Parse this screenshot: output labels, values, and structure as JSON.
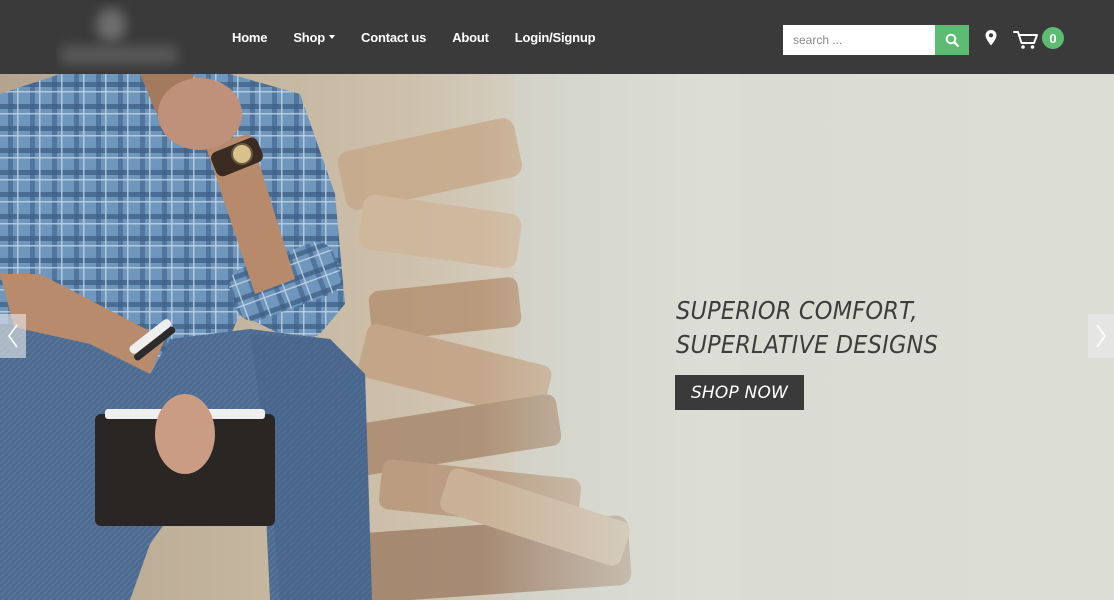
{
  "header": {
    "nav": [
      {
        "label": "Home"
      },
      {
        "label": "Shop",
        "has_dropdown": true
      },
      {
        "label": "Contact us"
      },
      {
        "label": "About"
      },
      {
        "label": "Login/Signup"
      }
    ],
    "search": {
      "placeholder": "search ...",
      "value": ""
    },
    "icons": {
      "search": "search-icon",
      "location": "map-pin-icon",
      "cart": "cart-icon"
    },
    "cart_count": "0"
  },
  "hero": {
    "headline_line1": "SUPERIOR COMFORT,",
    "headline_line2": "SUPERLATIVE DESIGNS",
    "cta_label": "SHOP NOW",
    "prev_icon": "chevron-left-icon",
    "next_icon": "chevron-right-icon"
  },
  "colors": {
    "topbar": "#3a3a3a",
    "accent_green": "#5cbd72",
    "hero_background": "#dcded6",
    "headline_text": "#3d3d3d",
    "cta_background": "#3a3a3a"
  }
}
